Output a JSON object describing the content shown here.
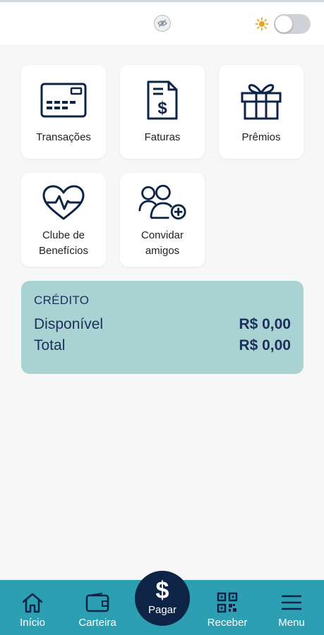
{
  "header": {
    "visibility_icon": "eye-off-icon",
    "theme_icon": "sun-icon",
    "theme_toggle_on": false,
    "colors": {
      "accent": "#e8a41c",
      "toggle_off": "#cfd2d6"
    }
  },
  "shortcuts": [
    {
      "label": "Transações",
      "icon": "credit-card-icon"
    },
    {
      "label": "Faturas",
      "icon": "invoice-icon"
    },
    {
      "label": "Prêmios",
      "icon": "gift-icon"
    },
    {
      "label_line1": "Clube de",
      "label_line2": "Benefícios",
      "icon": "heart-pulse-icon"
    },
    {
      "label_line1": "Convidar",
      "label_line2": "amigos",
      "icon": "add-users-icon"
    }
  ],
  "credit": {
    "title": "CRÉDITO",
    "available_label": "Disponível",
    "available_value": "R$ 0,00",
    "total_label": "Total",
    "total_value": "R$ 0,00",
    "background": "#a9d3d3"
  },
  "bottom_nav": {
    "items": [
      {
        "label": "Início",
        "icon": "home-icon"
      },
      {
        "label": "Carteira",
        "icon": "wallet-icon"
      },
      {
        "label": "Receber",
        "icon": "qr-code-icon"
      },
      {
        "label": "Menu",
        "icon": "menu-icon"
      }
    ],
    "pay": {
      "label": "Pagar",
      "symbol": "$"
    },
    "colors": {
      "bar": "#2d9fb3",
      "pay_button": "#0d2447"
    }
  }
}
